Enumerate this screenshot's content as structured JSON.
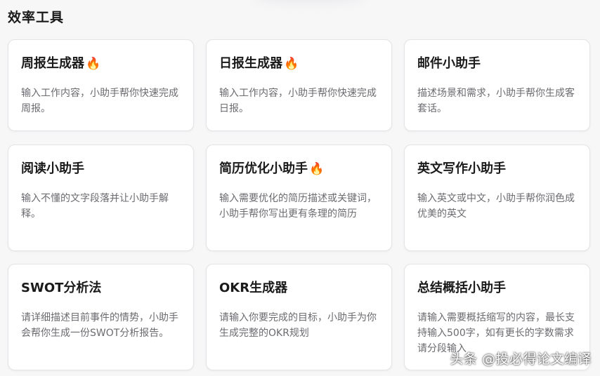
{
  "section": {
    "title": "效率工具"
  },
  "cards": [
    {
      "title": "周报生成器",
      "hot": true,
      "desc": "输入工作内容，小助手帮你快速完成周报。"
    },
    {
      "title": "日报生成器",
      "hot": true,
      "desc": "输入工作内容，小助手帮你快速完成日报。"
    },
    {
      "title": "邮件小助手",
      "hot": false,
      "desc": "描述场景和需求，小助手帮你生成客套话。"
    },
    {
      "title": "阅读小助手",
      "hot": false,
      "desc": "输入不懂的文字段落并让小助手解释。"
    },
    {
      "title": "简历优化小助手",
      "hot": true,
      "desc": "输入需要优化的简历描述或关键词，小助手帮你写出更有条理的简历"
    },
    {
      "title": "英文写作小助手",
      "hot": false,
      "desc": "输入英文或中文，小助手帮你润色成优美的英文"
    },
    {
      "title": "SWOT分析法",
      "hot": false,
      "desc": "请详细描述目前事件的情势，小助手会帮你生成一份SWOT分析报告。"
    },
    {
      "title": "OKR生成器",
      "hot": false,
      "desc": "请输入你要完成的目标，小助手为你生成完整的OKR规划"
    },
    {
      "title": "总结概括小助手",
      "hot": false,
      "desc": "请输入需要概括缩写的内容，最长支持输入500字，如有更长的字数需求请分段输入"
    }
  ],
  "icons": {
    "hot": "fire-icon"
  },
  "watermark": "头条 @投必得论文编译"
}
